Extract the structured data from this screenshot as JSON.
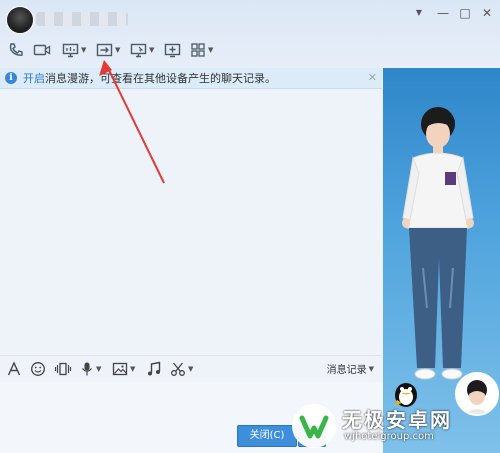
{
  "titlebar": {
    "controls": [
      "▼",
      "—",
      "□",
      "✕"
    ]
  },
  "notice": {
    "link_text": "开启",
    "text": "消息漫游，可查看在其他设备产生的聊天记录。",
    "close": "✕"
  },
  "bottom_toolbar": {
    "history_label": "消息记录"
  },
  "buttons": {
    "close_label": "关闭(C)"
  },
  "watermark": {
    "title": "无极安卓网",
    "url": "wjhotelgroup.com"
  },
  "colors": {
    "accent": "#3d8fdb",
    "arrow": "#e53935",
    "notice_bg": "#dcebf8"
  }
}
